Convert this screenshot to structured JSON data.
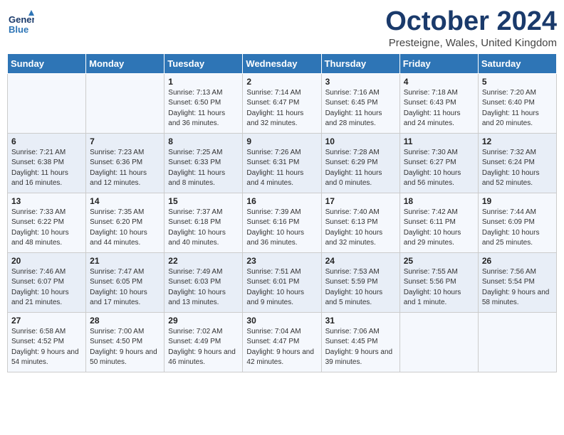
{
  "header": {
    "logo_line1": "General",
    "logo_line2": "Blue",
    "month": "October 2024",
    "location": "Presteigne, Wales, United Kingdom"
  },
  "weekdays": [
    "Sunday",
    "Monday",
    "Tuesday",
    "Wednesday",
    "Thursday",
    "Friday",
    "Saturday"
  ],
  "weeks": [
    [
      {
        "day": "",
        "info": ""
      },
      {
        "day": "",
        "info": ""
      },
      {
        "day": "1",
        "info": "Sunrise: 7:13 AM\nSunset: 6:50 PM\nDaylight: 11 hours and 36 minutes."
      },
      {
        "day": "2",
        "info": "Sunrise: 7:14 AM\nSunset: 6:47 PM\nDaylight: 11 hours and 32 minutes."
      },
      {
        "day": "3",
        "info": "Sunrise: 7:16 AM\nSunset: 6:45 PM\nDaylight: 11 hours and 28 minutes."
      },
      {
        "day": "4",
        "info": "Sunrise: 7:18 AM\nSunset: 6:43 PM\nDaylight: 11 hours and 24 minutes."
      },
      {
        "day": "5",
        "info": "Sunrise: 7:20 AM\nSunset: 6:40 PM\nDaylight: 11 hours and 20 minutes."
      }
    ],
    [
      {
        "day": "6",
        "info": "Sunrise: 7:21 AM\nSunset: 6:38 PM\nDaylight: 11 hours and 16 minutes."
      },
      {
        "day": "7",
        "info": "Sunrise: 7:23 AM\nSunset: 6:36 PM\nDaylight: 11 hours and 12 minutes."
      },
      {
        "day": "8",
        "info": "Sunrise: 7:25 AM\nSunset: 6:33 PM\nDaylight: 11 hours and 8 minutes."
      },
      {
        "day": "9",
        "info": "Sunrise: 7:26 AM\nSunset: 6:31 PM\nDaylight: 11 hours and 4 minutes."
      },
      {
        "day": "10",
        "info": "Sunrise: 7:28 AM\nSunset: 6:29 PM\nDaylight: 11 hours and 0 minutes."
      },
      {
        "day": "11",
        "info": "Sunrise: 7:30 AM\nSunset: 6:27 PM\nDaylight: 10 hours and 56 minutes."
      },
      {
        "day": "12",
        "info": "Sunrise: 7:32 AM\nSunset: 6:24 PM\nDaylight: 10 hours and 52 minutes."
      }
    ],
    [
      {
        "day": "13",
        "info": "Sunrise: 7:33 AM\nSunset: 6:22 PM\nDaylight: 10 hours and 48 minutes."
      },
      {
        "day": "14",
        "info": "Sunrise: 7:35 AM\nSunset: 6:20 PM\nDaylight: 10 hours and 44 minutes."
      },
      {
        "day": "15",
        "info": "Sunrise: 7:37 AM\nSunset: 6:18 PM\nDaylight: 10 hours and 40 minutes."
      },
      {
        "day": "16",
        "info": "Sunrise: 7:39 AM\nSunset: 6:16 PM\nDaylight: 10 hours and 36 minutes."
      },
      {
        "day": "17",
        "info": "Sunrise: 7:40 AM\nSunset: 6:13 PM\nDaylight: 10 hours and 32 minutes."
      },
      {
        "day": "18",
        "info": "Sunrise: 7:42 AM\nSunset: 6:11 PM\nDaylight: 10 hours and 29 minutes."
      },
      {
        "day": "19",
        "info": "Sunrise: 7:44 AM\nSunset: 6:09 PM\nDaylight: 10 hours and 25 minutes."
      }
    ],
    [
      {
        "day": "20",
        "info": "Sunrise: 7:46 AM\nSunset: 6:07 PM\nDaylight: 10 hours and 21 minutes."
      },
      {
        "day": "21",
        "info": "Sunrise: 7:47 AM\nSunset: 6:05 PM\nDaylight: 10 hours and 17 minutes."
      },
      {
        "day": "22",
        "info": "Sunrise: 7:49 AM\nSunset: 6:03 PM\nDaylight: 10 hours and 13 minutes."
      },
      {
        "day": "23",
        "info": "Sunrise: 7:51 AM\nSunset: 6:01 PM\nDaylight: 10 hours and 9 minutes."
      },
      {
        "day": "24",
        "info": "Sunrise: 7:53 AM\nSunset: 5:59 PM\nDaylight: 10 hours and 5 minutes."
      },
      {
        "day": "25",
        "info": "Sunrise: 7:55 AM\nSunset: 5:56 PM\nDaylight: 10 hours and 1 minute."
      },
      {
        "day": "26",
        "info": "Sunrise: 7:56 AM\nSunset: 5:54 PM\nDaylight: 9 hours and 58 minutes."
      }
    ],
    [
      {
        "day": "27",
        "info": "Sunrise: 6:58 AM\nSunset: 4:52 PM\nDaylight: 9 hours and 54 minutes."
      },
      {
        "day": "28",
        "info": "Sunrise: 7:00 AM\nSunset: 4:50 PM\nDaylight: 9 hours and 50 minutes."
      },
      {
        "day": "29",
        "info": "Sunrise: 7:02 AM\nSunset: 4:49 PM\nDaylight: 9 hours and 46 minutes."
      },
      {
        "day": "30",
        "info": "Sunrise: 7:04 AM\nSunset: 4:47 PM\nDaylight: 9 hours and 42 minutes."
      },
      {
        "day": "31",
        "info": "Sunrise: 7:06 AM\nSunset: 4:45 PM\nDaylight: 9 hours and 39 minutes."
      },
      {
        "day": "",
        "info": ""
      },
      {
        "day": "",
        "info": ""
      }
    ]
  ]
}
